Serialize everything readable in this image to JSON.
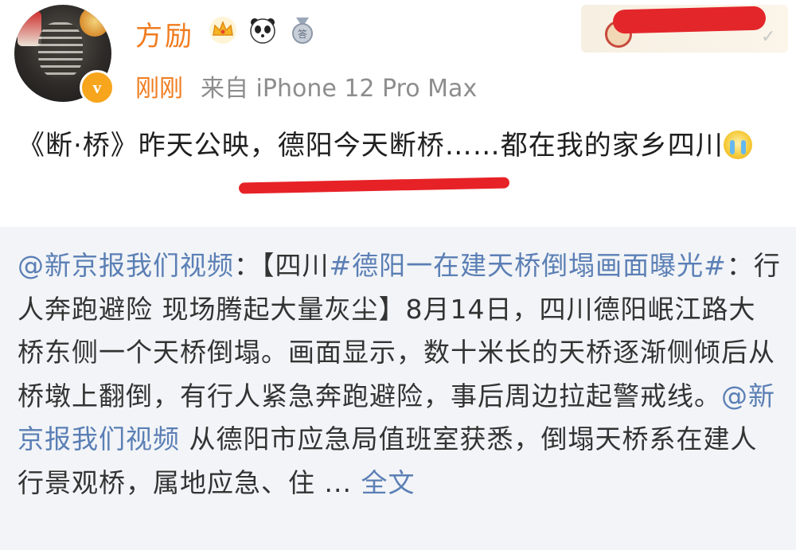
{
  "post": {
    "author": "方励",
    "badges": [
      "crown-icon",
      "panda-icon",
      "medal-icon"
    ],
    "verified_mark": "v",
    "time": "刚刚",
    "source": "来自 iPhone 12 Pro Max",
    "text_part1": "《断·桥》昨天公映，德阳今天断桥……都在我的家乡四川",
    "emoji": "cry-emoji-icon"
  },
  "repost": {
    "mention": "@新京报我们视频",
    "sep": "：【四川",
    "hashtag": "#德阳一在建天桥倒塌画面曝光#",
    "text_a": "：行人奔跑避险 现场腾起大量灰尘】8月14日，四川德阳岷江路大桥东侧一个天桥倒塌。画面显示，数十米长的天桥逐渐侧倾后从桥墩上翻倒，有行人紧急奔跑避险，事后周边拉起警戒线。",
    "mention2": "@新京报我们视频",
    "text_b": " 从德阳市应急局值班室获悉，倒塌天桥系在建人行景观桥，属地应急、住 ... ",
    "more": "全文"
  },
  "colors": {
    "name_orange": "#f07c1f",
    "link_blue": "#5b7fb5",
    "annotation_red": "#e62227",
    "repost_bg": "#f2f4f7"
  }
}
